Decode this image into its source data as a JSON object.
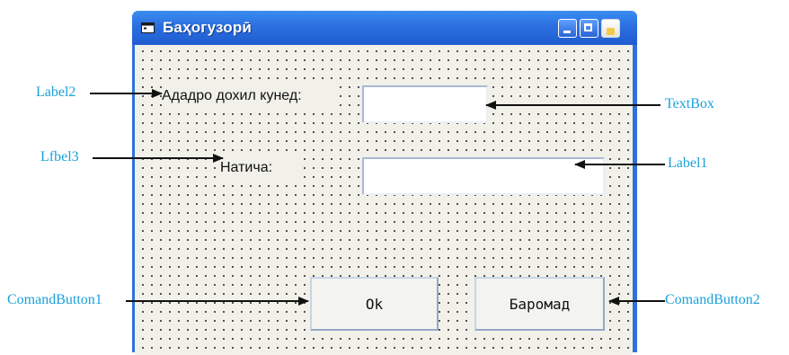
{
  "window": {
    "title": "Баҳогузорӣ",
    "icon": "form-icon"
  },
  "form": {
    "label2_text": "Ададро дохил кунед:",
    "label3_text": "Натича:",
    "textbox_value": "",
    "label1_value": "",
    "button1_label": "Ok",
    "button2_label": "Баромад"
  },
  "callouts": {
    "label2": "Label2",
    "label3": "Lfbel3",
    "textbox": "TextBox",
    "label1": "Label1",
    "button1": "ComandButton1",
    "button2": "ComandButton2"
  },
  "colors": {
    "callout_text": "#1aa0d8",
    "titlebar": "#2b6fe0",
    "form_background": "#f1f1e9"
  }
}
